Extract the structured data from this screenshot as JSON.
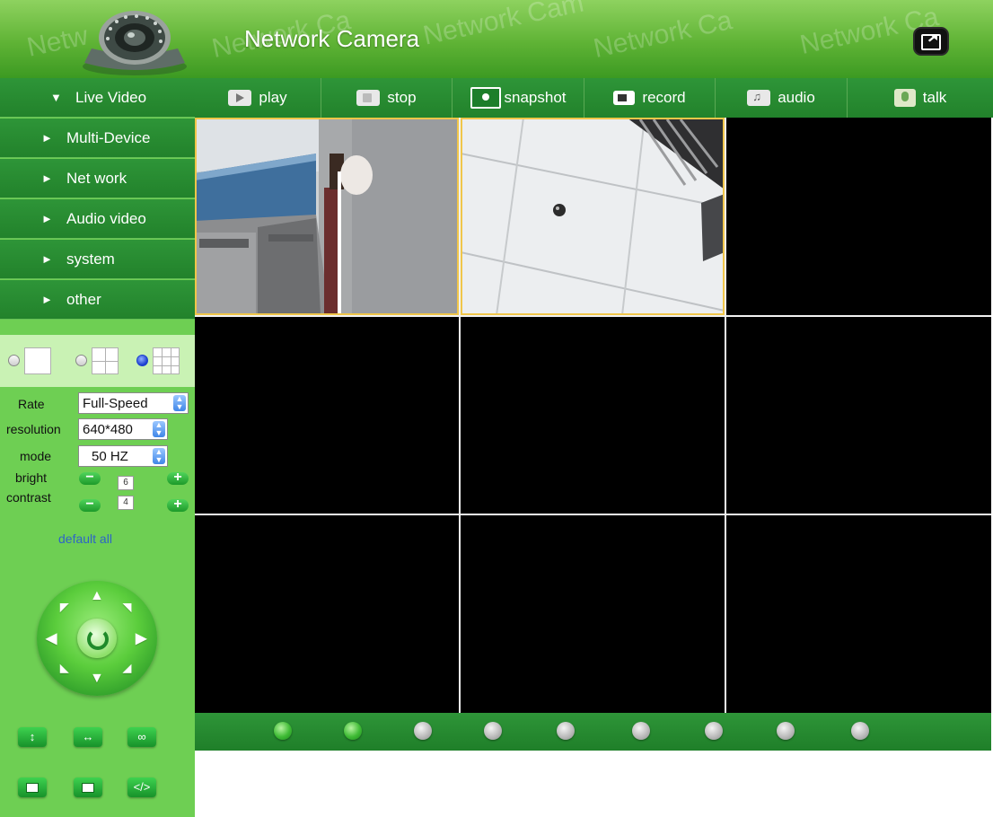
{
  "header": {
    "title": "Network Camera",
    "watermarks": [
      "Netw",
      "Network Ca",
      "Network Cam",
      "Network Ca",
      "Network Ca"
    ]
  },
  "menu": [
    {
      "label": "Live Video",
      "marker": "▼"
    },
    {
      "label": "Multi-Device",
      "marker": "►"
    },
    {
      "label": "Net work",
      "marker": "►"
    },
    {
      "label": "Audio video",
      "marker": "►"
    },
    {
      "label": "system",
      "marker": "►"
    },
    {
      "label": "other",
      "marker": "►"
    }
  ],
  "toolbar": {
    "play": "play",
    "stop": "stop",
    "snapshot": "snapshot",
    "record": "record",
    "audio": "audio",
    "talk": "talk"
  },
  "settings": {
    "rate_label": "Rate",
    "rate_value": "Full-Speed",
    "resolution_label": "resolution",
    "resolution_value": "640*480",
    "mode_label": "mode",
    "mode_value": "50 HZ",
    "bright_label": "bright",
    "bright_value": "6",
    "contrast_label": "contrast",
    "contrast_value": "4",
    "default_all": "default all"
  },
  "layout": {
    "selected": "9"
  },
  "channels": {
    "count": 9,
    "active": [
      1,
      2
    ]
  },
  "colors": {
    "accent": "#22822b",
    "sidebar": "#6ecf53",
    "link": "#2e64c6"
  }
}
